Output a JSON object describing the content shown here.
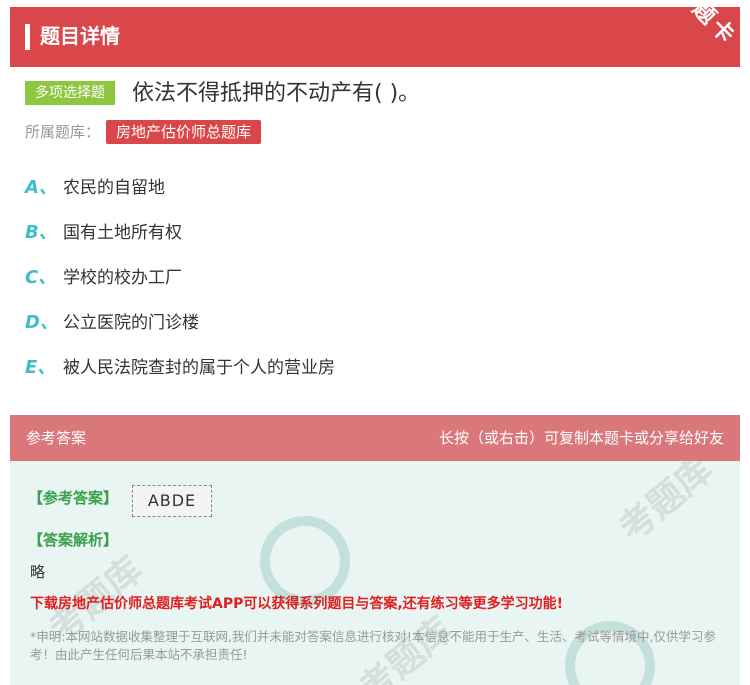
{
  "header": {
    "title": "题目详情",
    "corner_badge": "题卡"
  },
  "question": {
    "type_label": "多项选择题",
    "text": "依法不得抵押的不动产有( )。",
    "bank_label": "所属题库：",
    "bank_name": "房地产估价师总题库"
  },
  "options": [
    {
      "letter": "A、",
      "text": "农民的自留地"
    },
    {
      "letter": "B、",
      "text": "国有土地所有权"
    },
    {
      "letter": "C、",
      "text": "学校的校办工厂"
    },
    {
      "letter": "D、",
      "text": "公立医院的门诊楼"
    },
    {
      "letter": "E、",
      "text": "被人民法院查封的属于个人的营业房"
    }
  ],
  "answer_section": {
    "header_left": "参考答案",
    "header_right": "长按（或右击）可复制本题卡或分享给好友",
    "ref_answer_label": "【参考答案】",
    "ref_answer_value": "ABDE",
    "analysis_label": "【答案解析】",
    "analysis_text": "略",
    "promo": "下载房地产估价师总题库考试APP可以获得系列题目与答案,还有练习等更多学习功能!",
    "notice": "*申明:本网站数据收集整理于互联网,我们并未能对答案信息进行核对!本信息不能用于生产、生活、考试等情境中,仅供学习参考！由此产生任何后果本站不承担责任!"
  },
  "colors": {
    "header_red": "#d9474a",
    "type_green": "#8dc63f",
    "option_letter": "#3cbfc7",
    "answer_bg": "#e8f5f2"
  }
}
